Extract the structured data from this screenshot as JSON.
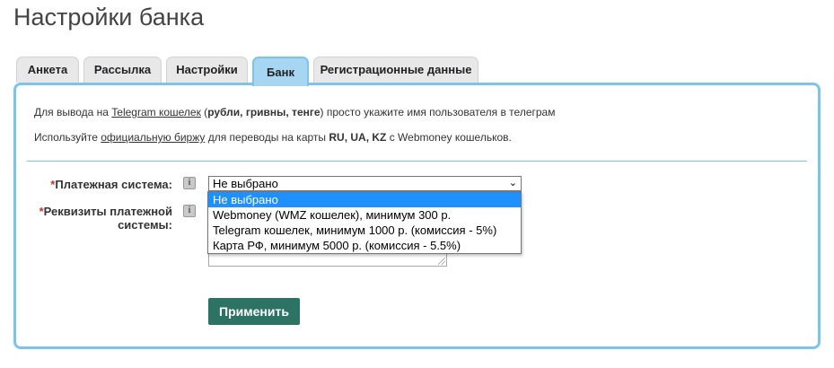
{
  "page": {
    "title": "Настройки банка"
  },
  "tabs": [
    {
      "label": "Анкета"
    },
    {
      "label": "Рассылка"
    },
    {
      "label": "Настройки"
    },
    {
      "label": "Банк"
    },
    {
      "label": "Регистрационные данные"
    }
  ],
  "info": {
    "line1": {
      "prefix": "Для вывода на ",
      "link": "Telegram кошелек",
      "mid": " (",
      "bold": "рубли, гривны, тенге",
      "suffix": ") просто укажите имя пользователя в телеграм"
    },
    "line2": {
      "prefix": "Используйте ",
      "link": "официальную биржу",
      "mid": " для переводы на карты ",
      "bold": "RU, UA, KZ",
      "suffix": " с Webmoney кошельков."
    }
  },
  "form": {
    "payment_system": {
      "required_mark": "*",
      "label": "Платежная система:",
      "value": "Не выбрано"
    },
    "requisites": {
      "required_mark": "*",
      "label_line1": "Реквизиты платежной",
      "label_line2": "системы:"
    },
    "options": [
      "Не выбрано",
      "Webmoney (WMZ кошелек), минимум 300 р.",
      "Telegram кошелек, минимум 1000 р. (комиссия - 5%)",
      "Карта РФ, минимум 5000 р. (комиссия - 5.5%)"
    ],
    "apply_label": "Применить"
  },
  "colors": {
    "accent_border": "#7cc3ee",
    "active_tab": "#a6d6f2",
    "button": "#2d7364",
    "highlight": "#1e90ff"
  }
}
